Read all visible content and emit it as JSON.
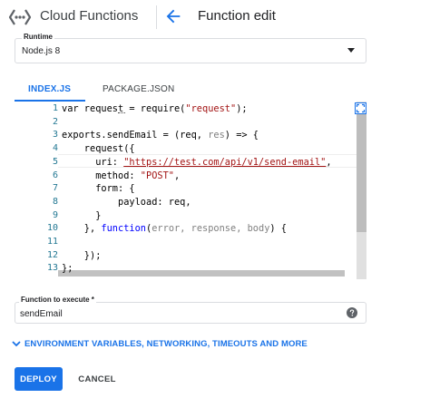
{
  "header": {
    "product_title": "Cloud Functions",
    "page_title": "Function edit",
    "logo_icon": "cloud-functions-logo-icon",
    "back_icon": "arrow-back-icon"
  },
  "runtime": {
    "label": "Runtime",
    "value": "Node.js 8"
  },
  "tabs": [
    {
      "label": "INDEX.JS",
      "active": true
    },
    {
      "label": "PACKAGE.JSON",
      "active": false
    }
  ],
  "editor": {
    "line_numbers": [
      "1",
      "2",
      "3",
      "4",
      "5",
      "6",
      "7",
      "8",
      "9",
      "10",
      "11",
      "12",
      "13"
    ],
    "lines": [
      {
        "t": [
          {
            "c": "plain",
            "v": "var request = require("
          },
          {
            "c": "str",
            "v": "\"request\""
          },
          {
            "c": "plain",
            "v": ");"
          }
        ]
      },
      {
        "t": []
      },
      {
        "t": [
          {
            "c": "plain",
            "v": "exports.sendEmail = (req, "
          },
          {
            "c": "param",
            "v": "res"
          },
          {
            "c": "plain",
            "v": ") => {"
          }
        ]
      },
      {
        "t": [
          {
            "c": "plain",
            "v": "    request({"
          }
        ]
      },
      {
        "t": [
          {
            "c": "plain",
            "v": "      uri: "
          },
          {
            "c": "link",
            "v": "\"https://test.com/api/v1/send-email\""
          },
          {
            "c": "plain",
            "v": ","
          }
        ]
      },
      {
        "t": [
          {
            "c": "plain",
            "v": "      method: "
          },
          {
            "c": "str",
            "v": "\"POST\""
          },
          {
            "c": "plain",
            "v": ","
          }
        ]
      },
      {
        "t": [
          {
            "c": "plain",
            "v": "      form: {"
          }
        ]
      },
      {
        "t": [
          {
            "c": "plain",
            "v": "          payload: req,"
          }
        ]
      },
      {
        "t": [
          {
            "c": "plain",
            "v": "      }"
          }
        ]
      },
      {
        "t": [
          {
            "c": "plain",
            "v": "    }, "
          },
          {
            "c": "kw",
            "v": "function"
          },
          {
            "c": "plain",
            "v": "("
          },
          {
            "c": "param",
            "v": "error, response, body"
          },
          {
            "c": "plain",
            "v": ") {"
          }
        ]
      },
      {
        "t": []
      },
      {
        "t": [
          {
            "c": "plain",
            "v": "    });"
          }
        ]
      },
      {
        "t": [
          {
            "c": "plain",
            "v": "};"
          }
        ]
      }
    ],
    "fullscreen_icon": "fullscreen-icon"
  },
  "function_to_execute": {
    "label": "Function to execute *",
    "value": "sendEmail",
    "help_icon": "help-icon"
  },
  "expander": {
    "label": "ENVIRONMENT VARIABLES, NETWORKING, TIMEOUTS AND MORE",
    "icon": "chevron-down-icon"
  },
  "actions": {
    "deploy_label": "DEPLOY",
    "cancel_label": "CANCEL"
  },
  "colors": {
    "accent": "#1a73e8",
    "line_number": "#237893",
    "string": "#a31515",
    "keyword": "#0000ff",
    "param": "#808080"
  }
}
